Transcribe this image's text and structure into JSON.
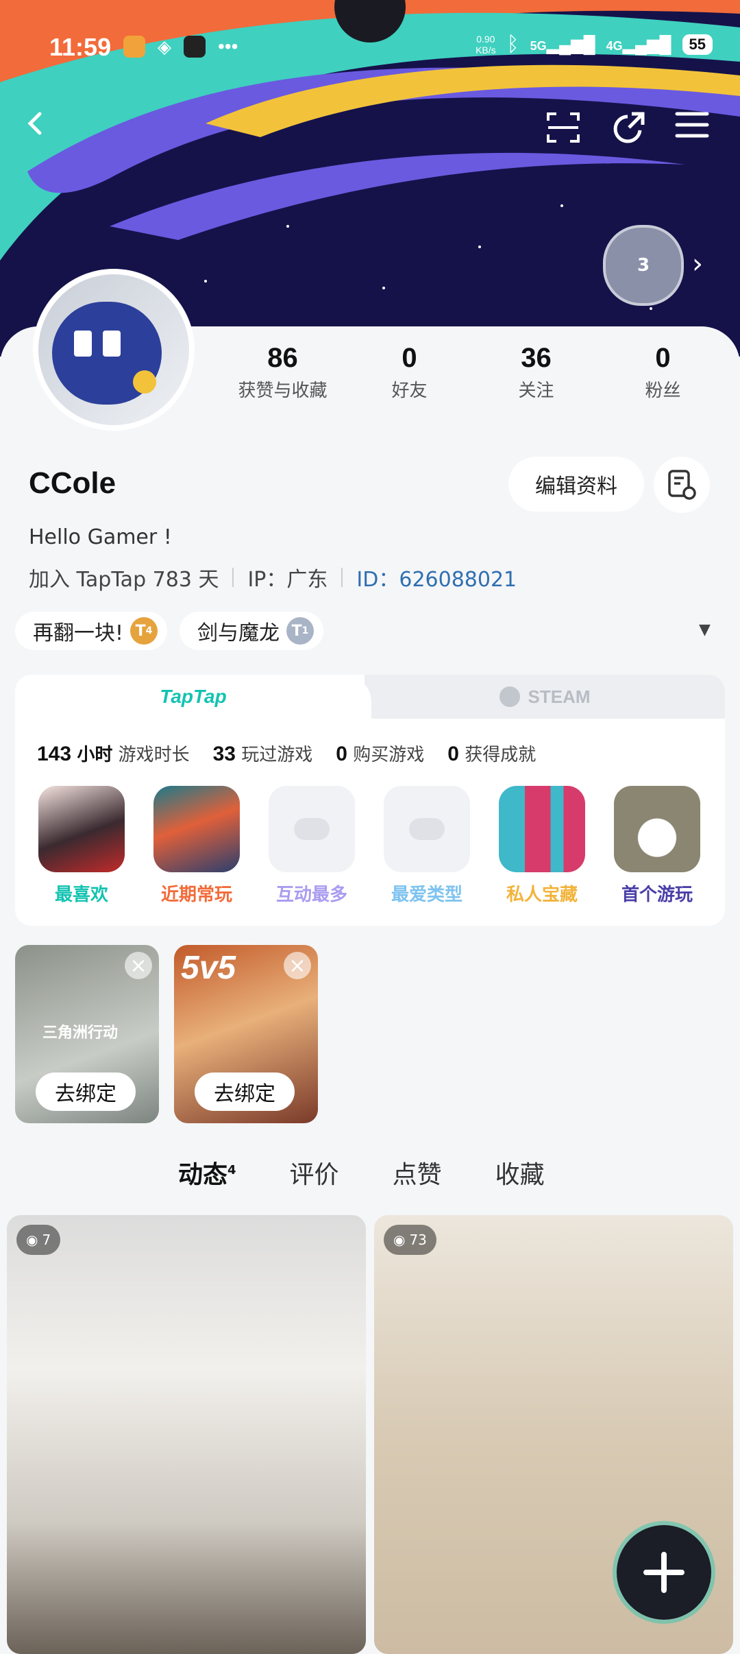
{
  "status_bar": {
    "time": "11:59",
    "net_speed": "0.90",
    "net_unit": "KB/s",
    "net_5g": "5G",
    "net_4g": "4G",
    "battery": "55"
  },
  "profile": {
    "username": "CCole",
    "bio": "Hello Gamer !",
    "joined": "加入 TapTap 783 天",
    "ip": "IP：广东",
    "id": "ID：626088021",
    "edit_label": "编辑资料",
    "medal_level": "3"
  },
  "stats": [
    {
      "num": "86",
      "label": "获赞与收藏"
    },
    {
      "num": "0",
      "label": "好友"
    },
    {
      "num": "36",
      "label": "关注"
    },
    {
      "num": "0",
      "label": "粉丝"
    }
  ],
  "tags": [
    {
      "label": "再翻一块!",
      "badge": "4",
      "color": "#e6a23c"
    },
    {
      "label": "剑与魔龙",
      "badge": "1",
      "color": "#a9b4c6"
    }
  ],
  "games_card": {
    "tab_taptap": "TapTap",
    "tab_steam": "STEAM",
    "playtime_num": "143",
    "playtime_unit": "小时",
    "playtime_label": "游戏时长",
    "played_num": "33",
    "played_label": "玩过游戏",
    "bought_num": "0",
    "bought_label": "购买游戏",
    "achieve_num": "0",
    "achieve_label": "获得成就",
    "icons": [
      {
        "label": "最喜欢",
        "color": "#13c3b1"
      },
      {
        "label": "近期常玩",
        "color": "#f26b3a"
      },
      {
        "label": "互动最多",
        "color": "#a99cf0"
      },
      {
        "label": "最爱类型",
        "color": "#7ec3f0"
      },
      {
        "label": "私人宝藏",
        "color": "#f2b33a"
      },
      {
        "label": "首个游玩",
        "color": "#4a3fa8"
      }
    ]
  },
  "bind_cards": [
    {
      "label": "去绑定",
      "game_text": "三角洲行动"
    },
    {
      "label": "去绑定",
      "game_text": "5v5"
    }
  ],
  "feed_tabs": {
    "dynamic": "动态",
    "dynamic_count": "4",
    "review": "评价",
    "like": "点赞",
    "collect": "收藏"
  },
  "posts": [
    {
      "views": "7"
    },
    {
      "views": "73"
    }
  ],
  "colors": {
    "accent": "#13c3b1",
    "header_bg": "#15124a",
    "id_link": "#2f6fb0"
  }
}
